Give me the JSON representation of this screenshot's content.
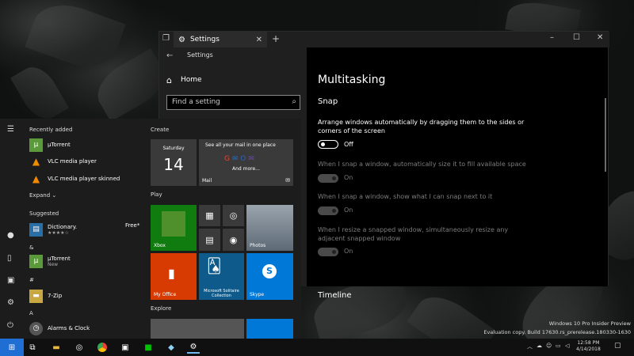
{
  "settings_window": {
    "tab_title": "Settings",
    "nav_title": "Settings",
    "home_label": "Home",
    "search_placeholder": "Find a setting",
    "page_title": "Multitasking",
    "snap_heading": "Snap",
    "options": [
      {
        "text": "Arrange windows automatically by dragging them to the sides or corners of the screen",
        "state": "Off",
        "enabled": true
      },
      {
        "text": "When I snap a window, automatically size it to fill available space",
        "state": "On",
        "enabled": false
      },
      {
        "text": "When I snap a window, show what I can snap next to it",
        "state": "On",
        "enabled": false
      },
      {
        "text": "When I resize a snapped window, simultaneously resize any adjacent snapped window",
        "state": "On",
        "enabled": false
      }
    ],
    "timeline_heading": "Timeline"
  },
  "start_menu": {
    "recently_added_label": "Recently added",
    "recent_apps": [
      "µTorrent",
      "VLC media player",
      "VLC media player skinned"
    ],
    "expand_label": "Expand",
    "suggested_label": "Suggested",
    "suggested_app": {
      "name": "Dictionary.",
      "rating": "★★★★☆",
      "price": "Free*"
    },
    "sections": [
      {
        "letter": "&",
        "app": "µTorrent",
        "sub": "New"
      },
      {
        "letter": "#",
        "app": "7-Zip",
        "sub": ""
      },
      {
        "letter": "A",
        "app": "Alarms & Clock",
        "sub": ""
      }
    ],
    "groups": {
      "create": "Create",
      "play": "Play",
      "explore": "Explore"
    },
    "calendar": {
      "day_name": "Saturday",
      "day_num": "14"
    },
    "mail": {
      "headline": "See all your mail in one place",
      "more": "And more...",
      "label": "Mail"
    },
    "tiles": {
      "xbox": "Xbox",
      "photos": "Photos",
      "myoffice": "My Office",
      "solitaire": "Microsoft Solitaire Collection",
      "skype": "Skype"
    }
  },
  "taskbar": {
    "time": "12:58 PM",
    "date": "4/14/2018",
    "watermark_line1": "Windows 10 Pro Insider Preview",
    "watermark_line2": "Evaluation copy. Build 17630.rs_prerelease.180330-1630"
  }
}
